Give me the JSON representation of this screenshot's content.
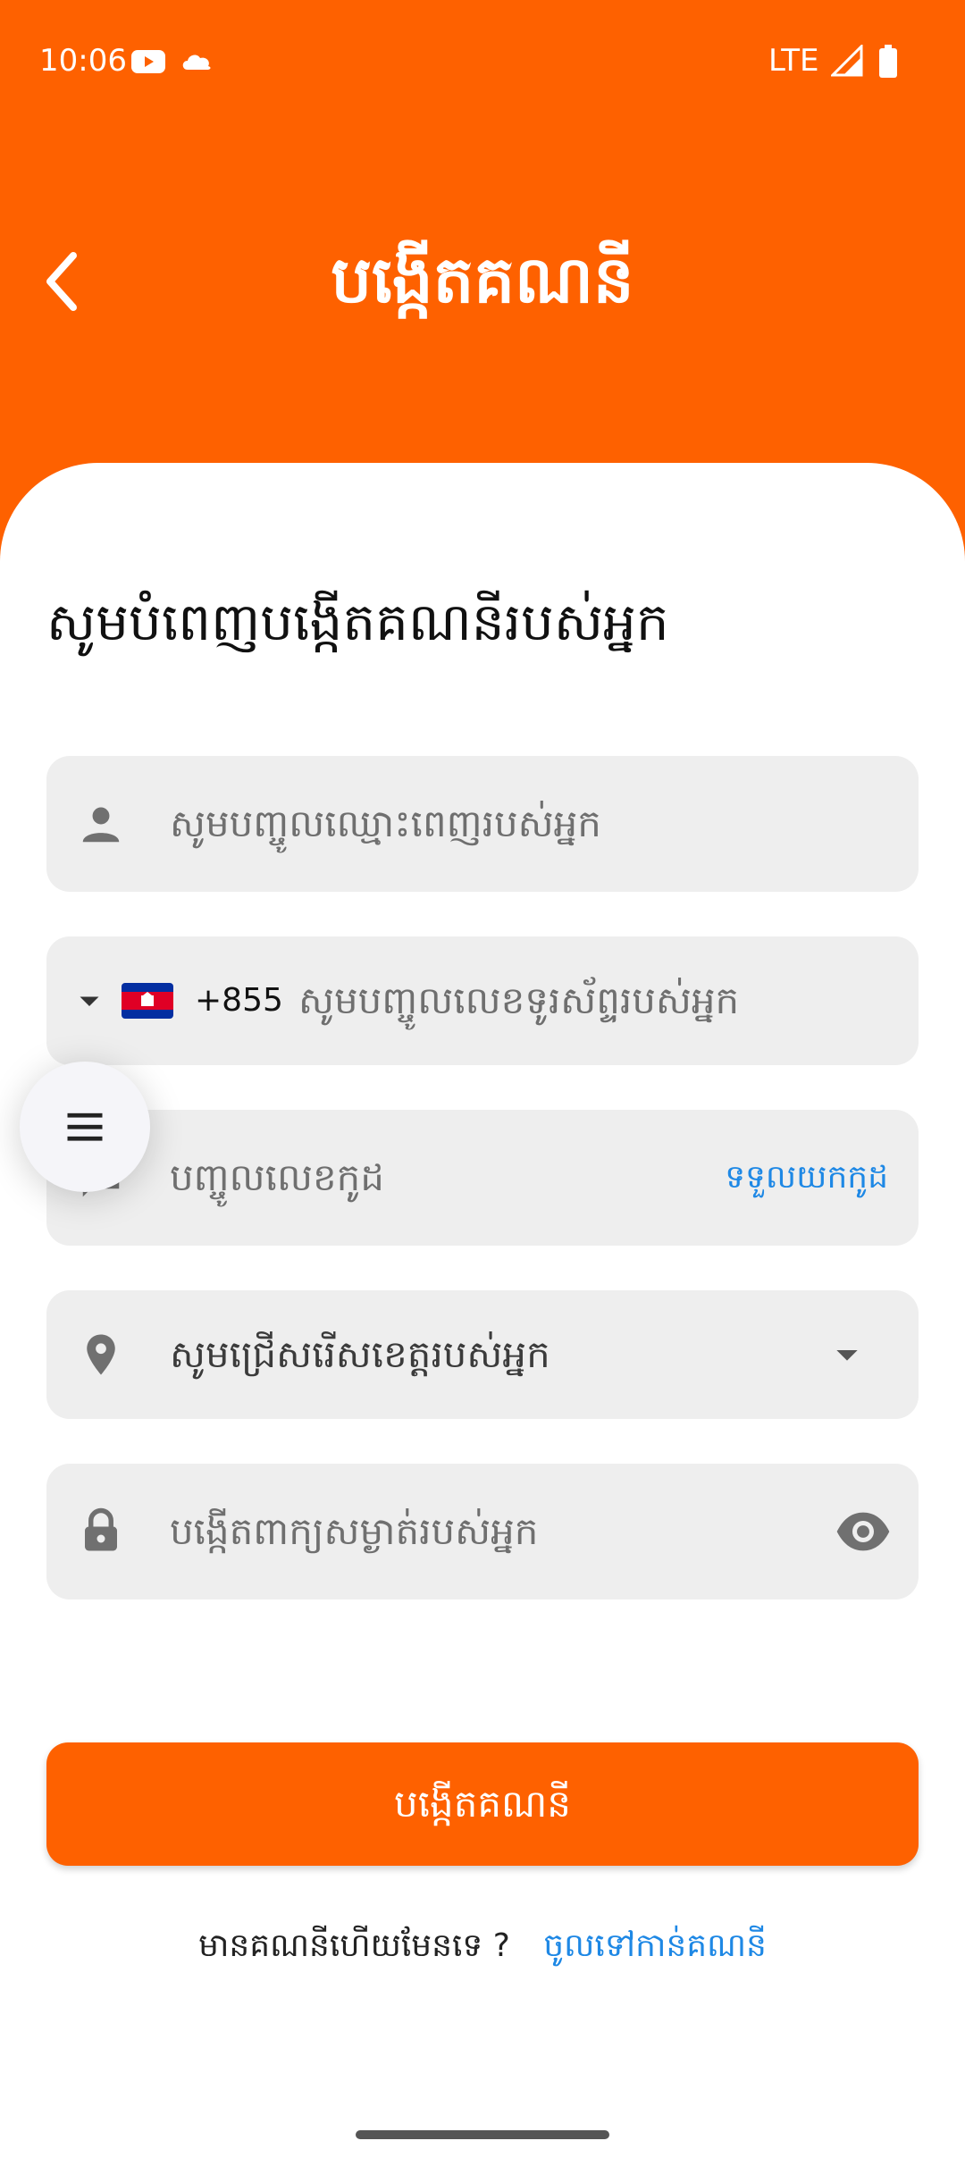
{
  "status_bar": {
    "time": "10:06",
    "network": "LTE",
    "icons": [
      "youtube-icon",
      "cloud-icon",
      "signal-icon",
      "battery-icon"
    ]
  },
  "header": {
    "title": "បង្កើតគណនី",
    "back_icon": "chevron-left-icon"
  },
  "form": {
    "section_title": "សូមបំពេញបង្កើតគណនីរបស់អ្នក",
    "name_field": {
      "icon": "person-icon",
      "placeholder": "សូមបញ្ចូលឈ្មោះពេញរបស់អ្នក"
    },
    "phone_field": {
      "dial_code": "+855",
      "country_flag": "cambodia-flag",
      "placeholder": "សូមបញ្ចូលលេខទូរស័ព្ទរបស់អ្នក"
    },
    "code_field": {
      "icon": "message-icon",
      "placeholder": "បញ្ចូលលេខកូដ",
      "get_code_label": "ទទួលយកកូដ"
    },
    "province_field": {
      "icon": "location-pin-icon",
      "value": "សូមជ្រើសរើសខេត្តរបស់អ្នក"
    },
    "password_field": {
      "icon": "lock-icon",
      "placeholder": "បង្កើតពាក្យសម្ងាត់របស់អ្នក",
      "toggle_icon": "eye-icon"
    },
    "submit_label": "បង្កើតគណនី"
  },
  "footer": {
    "question": "មានគណនីហើយមែនទេ ?",
    "login_link": "ចូលទៅកាន់គណនី"
  },
  "fab": {
    "icon": "menu-icon"
  },
  "colors": {
    "brand": "#FE6100",
    "link": "#1E88E5",
    "field_bg": "#EEEEEE"
  }
}
